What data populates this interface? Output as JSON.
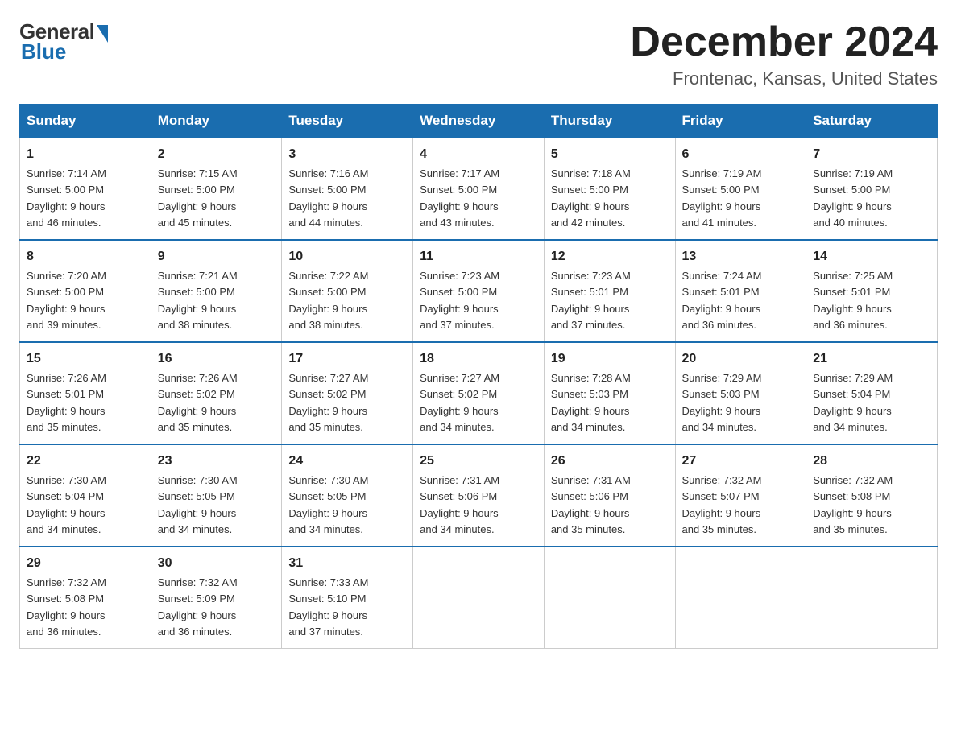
{
  "header": {
    "logo_general": "General",
    "logo_blue": "Blue",
    "month_title": "December 2024",
    "location": "Frontenac, Kansas, United States"
  },
  "calendar": {
    "days_of_week": [
      "Sunday",
      "Monday",
      "Tuesday",
      "Wednesday",
      "Thursday",
      "Friday",
      "Saturday"
    ],
    "weeks": [
      [
        {
          "day": "1",
          "sunrise": "7:14 AM",
          "sunset": "5:00 PM",
          "daylight": "9 hours and 46 minutes."
        },
        {
          "day": "2",
          "sunrise": "7:15 AM",
          "sunset": "5:00 PM",
          "daylight": "9 hours and 45 minutes."
        },
        {
          "day": "3",
          "sunrise": "7:16 AM",
          "sunset": "5:00 PM",
          "daylight": "9 hours and 44 minutes."
        },
        {
          "day": "4",
          "sunrise": "7:17 AM",
          "sunset": "5:00 PM",
          "daylight": "9 hours and 43 minutes."
        },
        {
          "day": "5",
          "sunrise": "7:18 AM",
          "sunset": "5:00 PM",
          "daylight": "9 hours and 42 minutes."
        },
        {
          "day": "6",
          "sunrise": "7:19 AM",
          "sunset": "5:00 PM",
          "daylight": "9 hours and 41 minutes."
        },
        {
          "day": "7",
          "sunrise": "7:19 AM",
          "sunset": "5:00 PM",
          "daylight": "9 hours and 40 minutes."
        }
      ],
      [
        {
          "day": "8",
          "sunrise": "7:20 AM",
          "sunset": "5:00 PM",
          "daylight": "9 hours and 39 minutes."
        },
        {
          "day": "9",
          "sunrise": "7:21 AM",
          "sunset": "5:00 PM",
          "daylight": "9 hours and 38 minutes."
        },
        {
          "day": "10",
          "sunrise": "7:22 AM",
          "sunset": "5:00 PM",
          "daylight": "9 hours and 38 minutes."
        },
        {
          "day": "11",
          "sunrise": "7:23 AM",
          "sunset": "5:00 PM",
          "daylight": "9 hours and 37 minutes."
        },
        {
          "day": "12",
          "sunrise": "7:23 AM",
          "sunset": "5:01 PM",
          "daylight": "9 hours and 37 minutes."
        },
        {
          "day": "13",
          "sunrise": "7:24 AM",
          "sunset": "5:01 PM",
          "daylight": "9 hours and 36 minutes."
        },
        {
          "day": "14",
          "sunrise": "7:25 AM",
          "sunset": "5:01 PM",
          "daylight": "9 hours and 36 minutes."
        }
      ],
      [
        {
          "day": "15",
          "sunrise": "7:26 AM",
          "sunset": "5:01 PM",
          "daylight": "9 hours and 35 minutes."
        },
        {
          "day": "16",
          "sunrise": "7:26 AM",
          "sunset": "5:02 PM",
          "daylight": "9 hours and 35 minutes."
        },
        {
          "day": "17",
          "sunrise": "7:27 AM",
          "sunset": "5:02 PM",
          "daylight": "9 hours and 35 minutes."
        },
        {
          "day": "18",
          "sunrise": "7:27 AM",
          "sunset": "5:02 PM",
          "daylight": "9 hours and 34 minutes."
        },
        {
          "day": "19",
          "sunrise": "7:28 AM",
          "sunset": "5:03 PM",
          "daylight": "9 hours and 34 minutes."
        },
        {
          "day": "20",
          "sunrise": "7:29 AM",
          "sunset": "5:03 PM",
          "daylight": "9 hours and 34 minutes."
        },
        {
          "day": "21",
          "sunrise": "7:29 AM",
          "sunset": "5:04 PM",
          "daylight": "9 hours and 34 minutes."
        }
      ],
      [
        {
          "day": "22",
          "sunrise": "7:30 AM",
          "sunset": "5:04 PM",
          "daylight": "9 hours and 34 minutes."
        },
        {
          "day": "23",
          "sunrise": "7:30 AM",
          "sunset": "5:05 PM",
          "daylight": "9 hours and 34 minutes."
        },
        {
          "day": "24",
          "sunrise": "7:30 AM",
          "sunset": "5:05 PM",
          "daylight": "9 hours and 34 minutes."
        },
        {
          "day": "25",
          "sunrise": "7:31 AM",
          "sunset": "5:06 PM",
          "daylight": "9 hours and 34 minutes."
        },
        {
          "day": "26",
          "sunrise": "7:31 AM",
          "sunset": "5:06 PM",
          "daylight": "9 hours and 35 minutes."
        },
        {
          "day": "27",
          "sunrise": "7:32 AM",
          "sunset": "5:07 PM",
          "daylight": "9 hours and 35 minutes."
        },
        {
          "day": "28",
          "sunrise": "7:32 AM",
          "sunset": "5:08 PM",
          "daylight": "9 hours and 35 minutes."
        }
      ],
      [
        {
          "day": "29",
          "sunrise": "7:32 AM",
          "sunset": "5:08 PM",
          "daylight": "9 hours and 36 minutes."
        },
        {
          "day": "30",
          "sunrise": "7:32 AM",
          "sunset": "5:09 PM",
          "daylight": "9 hours and 36 minutes."
        },
        {
          "day": "31",
          "sunrise": "7:33 AM",
          "sunset": "5:10 PM",
          "daylight": "9 hours and 37 minutes."
        },
        null,
        null,
        null,
        null
      ]
    ]
  }
}
